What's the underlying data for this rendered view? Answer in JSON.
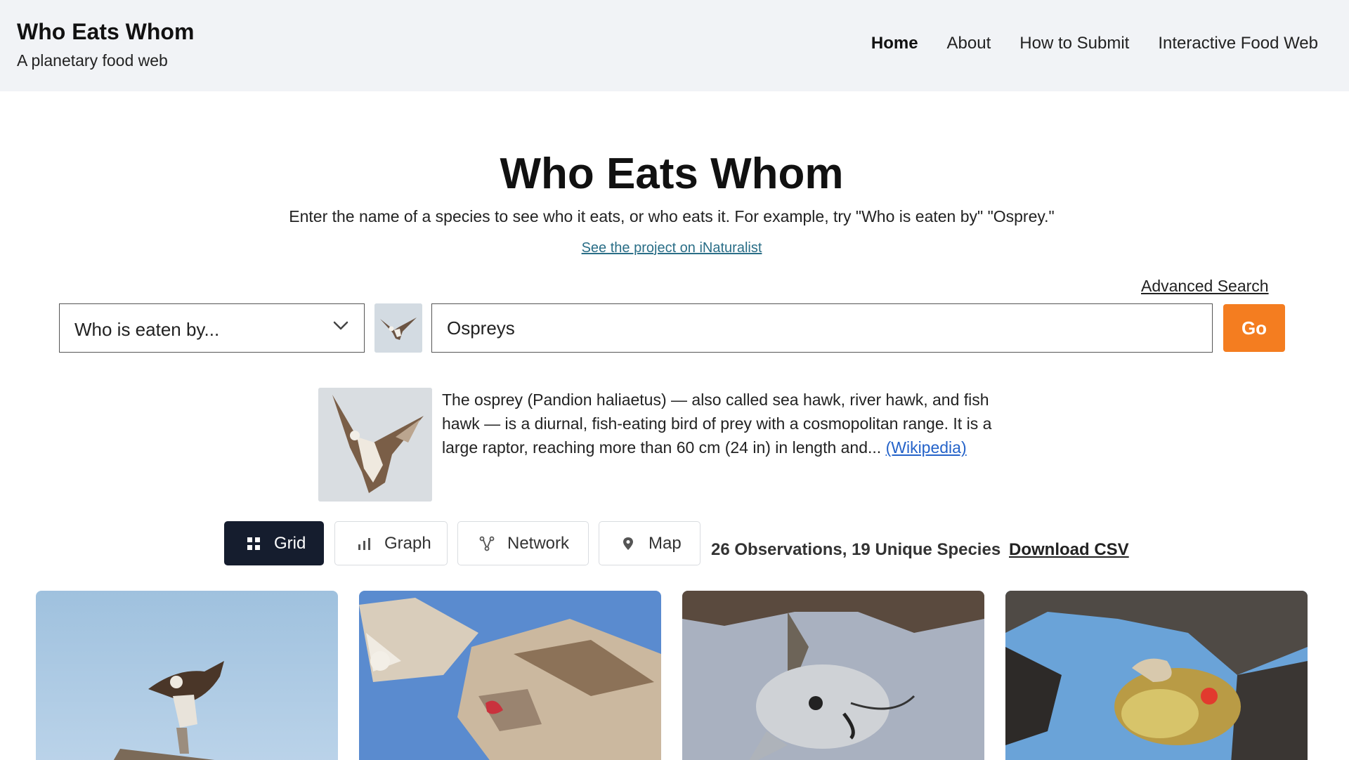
{
  "header": {
    "title": "Who Eats Whom",
    "subtitle": "A planetary food web",
    "nav": [
      {
        "label": "Home",
        "active": true
      },
      {
        "label": "About"
      },
      {
        "label": "How to Submit"
      },
      {
        "label": "Interactive Food Web"
      }
    ]
  },
  "hero": {
    "title": "Who Eats Whom",
    "description": "Enter the name of a species to see who it eats, or who eats it. For example, try \"Who is eaten by\" \"Osprey.\"",
    "inat_link": "See the project on iNaturalist"
  },
  "search": {
    "advanced_label": "Advanced Search",
    "mode": "Who is eaten by...",
    "query": "Ospreys",
    "go_label": "Go"
  },
  "species_info": {
    "text": "The osprey (Pandion haliaetus) — also called sea hawk, river hawk, and fish hawk — is a diurnal, fish-eating bird of prey with a cosmopolitan range. It is a large raptor, reaching more than 60 cm (24 in) in length and... ",
    "link_label": "(Wikipedia)"
  },
  "views": {
    "grid": "Grid",
    "graph": "Graph",
    "network": "Network",
    "map": "Map",
    "active": "Grid"
  },
  "results": {
    "summary": "26 Observations, 19 Unique Species",
    "csv_label": "Download CSV"
  },
  "icons": {
    "dropdown": "chevron-down-icon",
    "grid": "grid-icon",
    "graph": "bar-chart-icon",
    "network": "network-icon",
    "map": "map-pin-icon"
  },
  "colors": {
    "accent": "#f47d20",
    "active_view": "#151d2e",
    "header_bg": "#f1f3f6",
    "link": "#2563c9"
  }
}
